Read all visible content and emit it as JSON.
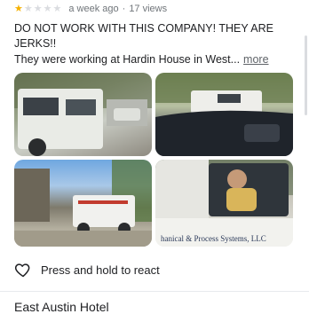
{
  "review": {
    "rating": 1,
    "max_rating": 5,
    "time_ago": "a week ago",
    "separator": "·",
    "views": "17 views",
    "title_text": "DO NOT WORK WITH THIS COMPANY! THEY ARE JERKS!!",
    "body_preview": "They were working at Hardin House in West...",
    "more_label": "more"
  },
  "photos": [
    {
      "name": "photo-white-truck-side"
    },
    {
      "name": "photo-truck-street-view"
    },
    {
      "name": "photo-truck-driveway"
    },
    {
      "name": "photo-driver-in-truck",
      "decal_text": "hanical & Process Systems, LLC"
    }
  ],
  "actions": {
    "react_label": "Press and hold to react",
    "react_icon": "heart-outline-icon"
  },
  "next_place": {
    "title": "East Austin Hotel"
  },
  "colors": {
    "star_filled": "#f6b100",
    "star_empty": "#dadce0",
    "text_primary": "#202124",
    "text_secondary": "#70757a"
  }
}
